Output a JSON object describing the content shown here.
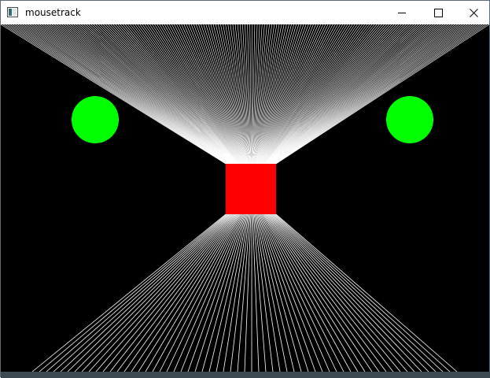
{
  "window": {
    "title": "mousetrack",
    "controls": [
      "minimize",
      "maximize",
      "close"
    ]
  },
  "scene": {
    "background": "#000000",
    "line_color": "#ffffff",
    "square_color": "#ff0000",
    "circle_color": "#00ff00"
  }
}
